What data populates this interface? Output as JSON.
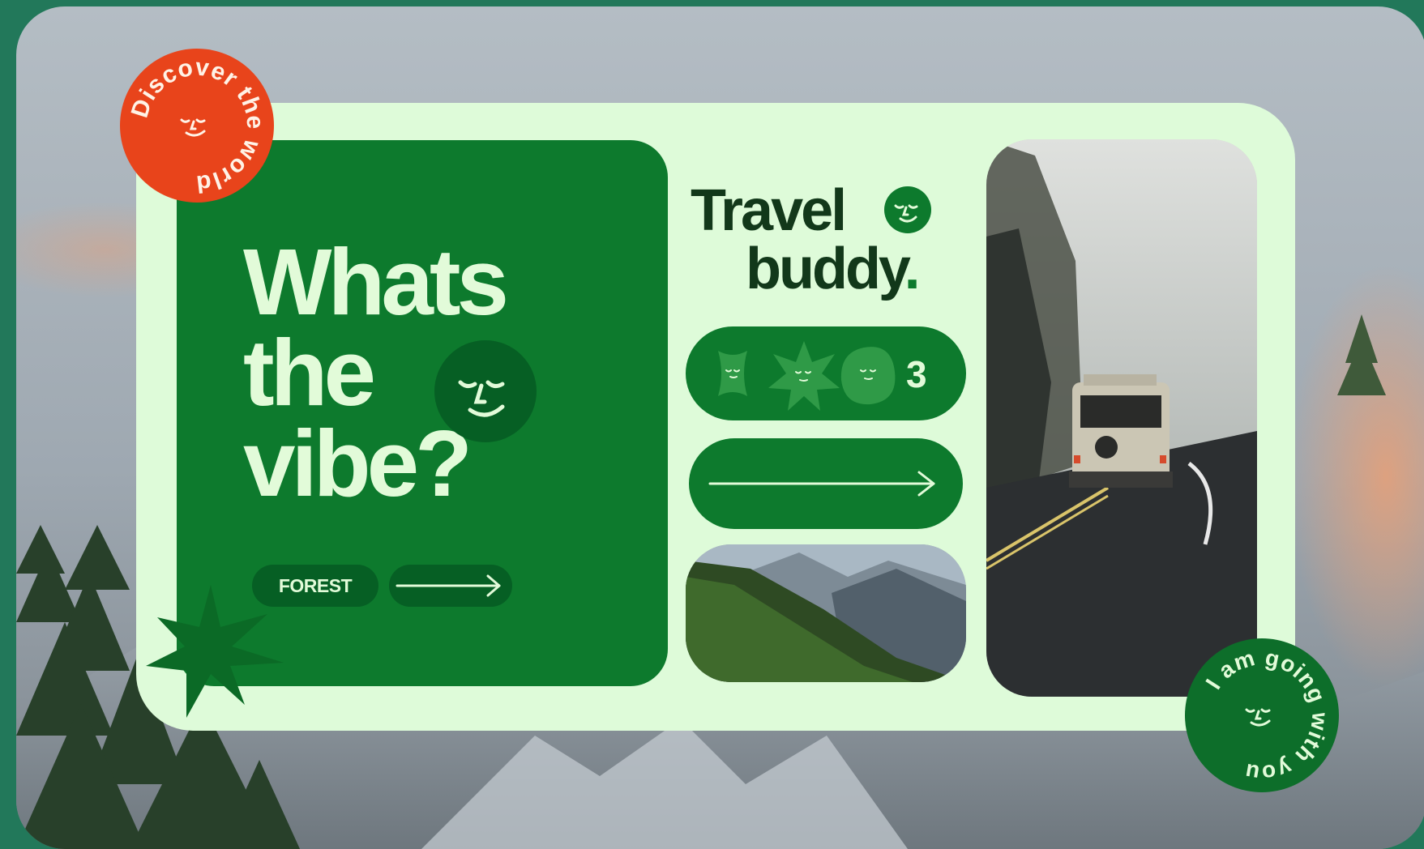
{
  "badge_top": {
    "text": "Discover the world"
  },
  "headline": {
    "line1": "Whats",
    "line2": "the",
    "line3": "vibe?"
  },
  "tag": {
    "label": "FOREST"
  },
  "brand": {
    "line1": "Travel",
    "line2": "buddy",
    "dot": "."
  },
  "rating": {
    "count": "3"
  },
  "badge_bottom": {
    "text": "I am going with you"
  },
  "colors": {
    "primary_green": "#0d7a2d",
    "dark_green": "#065f24",
    "mint": "#defbd9",
    "orange": "#e8441b",
    "text_dark": "#12381a"
  },
  "icons": [
    "smile-face-icon",
    "arrow-right-icon",
    "flower-icon",
    "starburst-icon",
    "blob-icon",
    "star-icon"
  ]
}
